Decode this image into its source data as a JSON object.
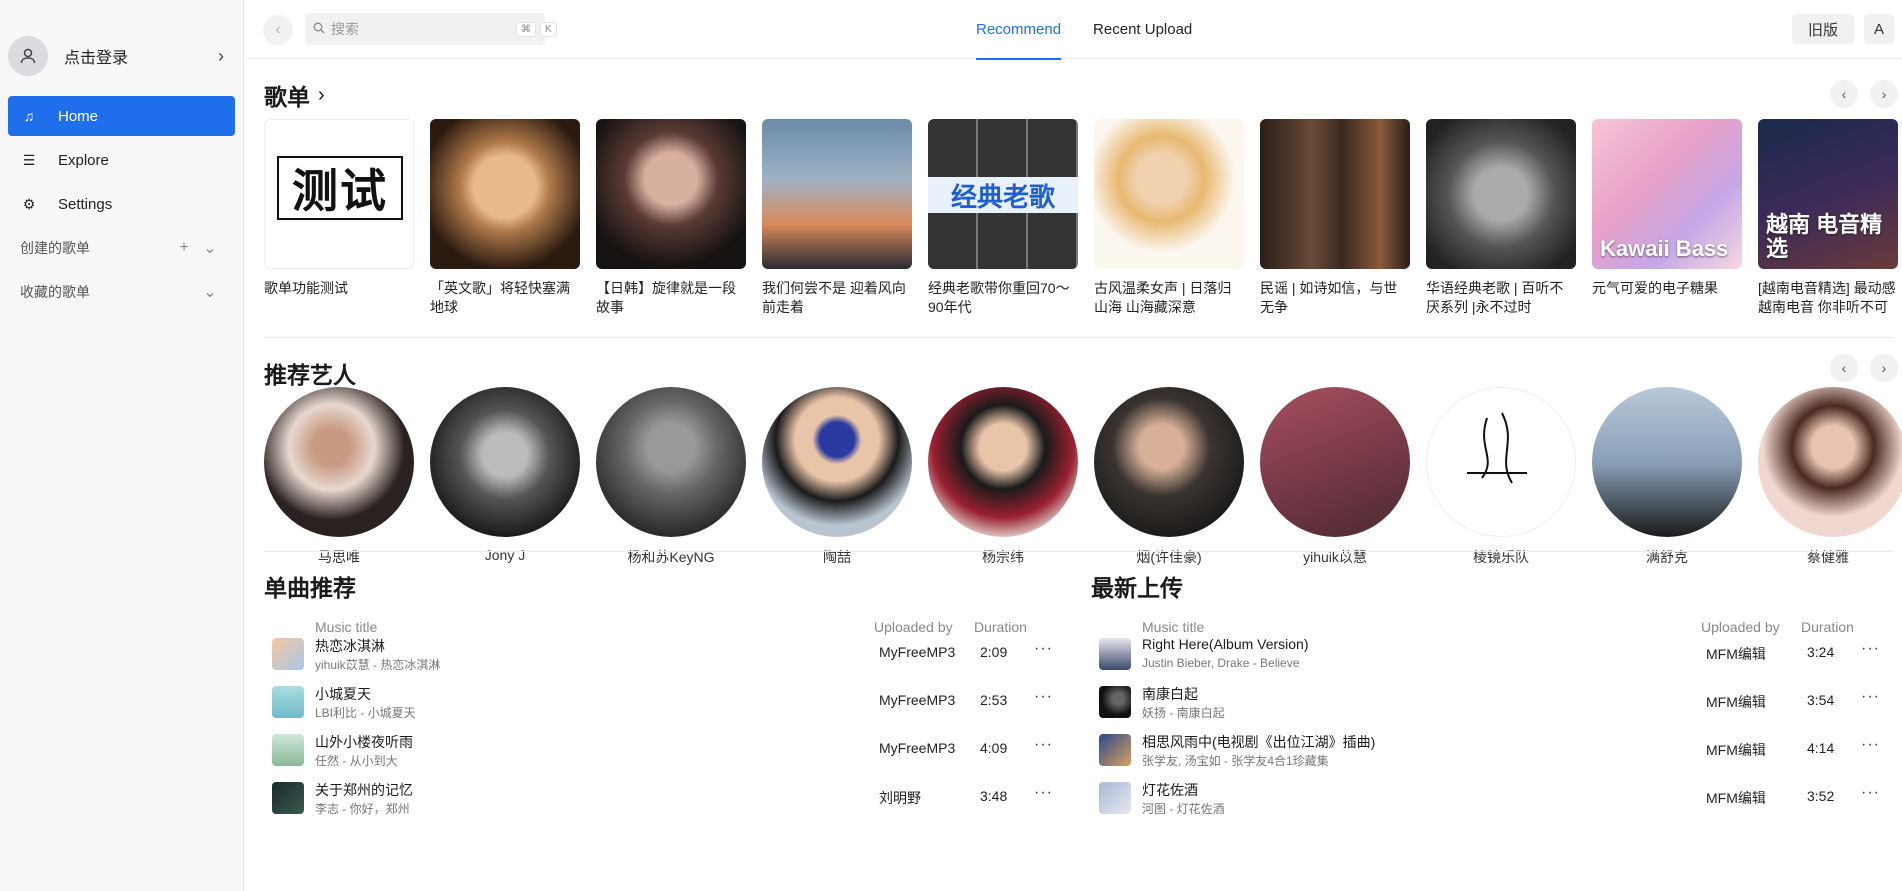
{
  "sidebar": {
    "user_label": "点击登录",
    "nav": [
      {
        "label": "Home"
      },
      {
        "label": "Explore"
      },
      {
        "label": "Settings"
      }
    ],
    "groups": [
      {
        "label": "创建的歌单"
      },
      {
        "label": "收藏的歌单"
      }
    ]
  },
  "topbar": {
    "search_placeholder": "搜索",
    "kbd1": "⌘",
    "kbd2": "K",
    "tabs": [
      {
        "label": "Recommend"
      },
      {
        "label": "Recent Upload"
      }
    ],
    "old_label": "旧版",
    "lang_label": "A"
  },
  "playlists_section": {
    "title": "歌单",
    "items": [
      {
        "title": "歌单功能测试",
        "cover_text": "测试"
      },
      {
        "title": "「英文歌」将轻快塞满地球"
      },
      {
        "title": "【日韩】旋律就是一段故事"
      },
      {
        "title": "我们何尝不是 迎着风向前走着"
      },
      {
        "title": "经典老歌带你重回70～90年代",
        "cover_text": "经典老歌"
      },
      {
        "title": "古风温柔女声 | 日落归山海 山海藏深意"
      },
      {
        "title": "民谣 | 如诗如信，与世无争"
      },
      {
        "title": "华语经典老歌 | 百听不厌系列 |永不过时"
      },
      {
        "title": "元气可爱的电子糖果",
        "cover_text": "Kawaii Bass"
      },
      {
        "title": "[越南电音精选] 最动感越南电音 你非听不可",
        "cover_text": "越南 电音精选"
      }
    ]
  },
  "artists_section": {
    "title": "推荐艺人",
    "items": [
      {
        "name": "马思唯"
      },
      {
        "name": "Jony J"
      },
      {
        "name": "杨和苏KeyNG"
      },
      {
        "name": "陶喆"
      },
      {
        "name": "杨宗纬"
      },
      {
        "name": "烟(许佳豪)"
      },
      {
        "name": "yihuik苡慧"
      },
      {
        "name": "棱镜乐队"
      },
      {
        "name": "满舒克"
      },
      {
        "name": "蔡健雅"
      }
    ]
  },
  "singles": {
    "title": "单曲推荐",
    "col_title": "Music title",
    "col_uploader": "Uploaded by",
    "col_duration": "Duration",
    "rows": [
      {
        "title": "热恋冰淇淋",
        "sub": "yihuik苡慧 - 热恋冰淇淋",
        "uploader": "MyFreeMP3",
        "duration": "2:09",
        "more": "···"
      },
      {
        "title": "小城夏天",
        "sub": "LBI利比 - 小城夏天",
        "uploader": "MyFreeMP3",
        "duration": "2:53",
        "more": "···"
      },
      {
        "title": "山外小楼夜听雨",
        "sub": "任然 - 从小到大",
        "uploader": "MyFreeMP3",
        "duration": "4:09",
        "more": "···"
      },
      {
        "title": "关于郑州的记忆",
        "sub": "李志 - 你好，郑州",
        "uploader": "刘明野",
        "duration": "3:48",
        "more": "···"
      }
    ]
  },
  "latest": {
    "title": "最新上传",
    "col_title": "Music title",
    "col_uploader": "Uploaded by",
    "col_duration": "Duration",
    "rows": [
      {
        "title": "Right Here(Album Version)",
        "sub": "Justin Bieber, Drake - Believe",
        "uploader": "MFM编辑",
        "duration": "3:24",
        "more": "···"
      },
      {
        "title": "南康白起",
        "sub": "妖扬 - 南康白起",
        "uploader": "MFM编辑",
        "duration": "3:54",
        "more": "···"
      },
      {
        "title": "相思风雨中(电视剧《出位江湖》插曲)",
        "sub": "张学友, 汤宝如 - 张学友4合1珍藏集",
        "uploader": "MFM编辑",
        "duration": "4:14",
        "more": "···"
      },
      {
        "title": "灯花佐酒",
        "sub": "河图 - 灯花佐酒",
        "uploader": "MFM编辑",
        "duration": "3:52",
        "more": "···"
      }
    ]
  },
  "colors": {
    "accent": "#1f6fec"
  }
}
